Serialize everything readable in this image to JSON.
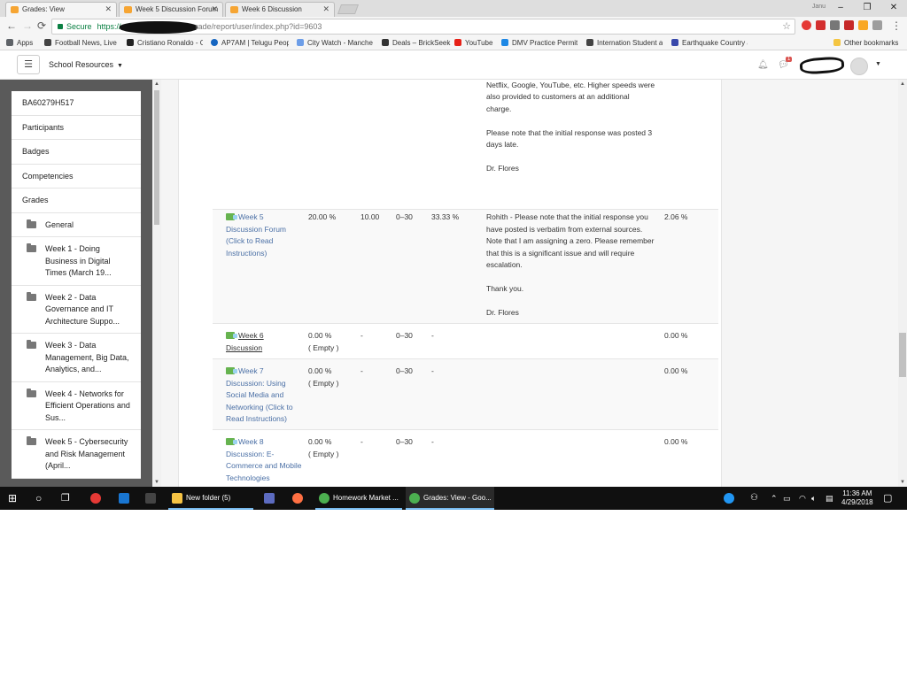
{
  "browser": {
    "tabs": [
      {
        "label": "Grades: View",
        "active": true
      },
      {
        "label": "Week 5 Discussion Forum",
        "active": false
      },
      {
        "label": "Week 6 Discussion",
        "active": false
      }
    ],
    "profile_name": "Janu",
    "window_controls": [
      "–",
      "❐",
      "✕"
    ],
    "address": {
      "secure_label": "Secure",
      "url_prefix": "https://",
      "url_suffix": "rade/report/user/index.php?id=9603"
    },
    "bookmarks": [
      {
        "label": "Apps",
        "icon_color": "#5f6368"
      },
      {
        "label": "Football News, Live S",
        "icon_color": "#444444"
      },
      {
        "label": "Cristiano Ronaldo - C",
        "icon_color": "#222222"
      },
      {
        "label": "AP7AM | Telugu Peop",
        "icon_color": "#1565c0"
      },
      {
        "label": "City Watch - Manche",
        "icon_color": "#6d9ee8"
      },
      {
        "label": "Deals – BrickSeek",
        "icon_color": "#333333"
      },
      {
        "label": "YouTube",
        "icon_color": "#e62117"
      },
      {
        "label": "DMV Practice Permit",
        "icon_color": "#1e88e5"
      },
      {
        "label": "Internation Student a",
        "icon_color": "#444444"
      },
      {
        "label": "Earthquake Country a",
        "icon_color": "#3949ab"
      },
      {
        "label": "Other bookmarks",
        "icon_color": "#f4c542"
      }
    ]
  },
  "navbar": {
    "menu_icon": "☰",
    "site_menu_label": "School Resources",
    "message_count": "1"
  },
  "drawer": {
    "items": [
      "BA60279H517",
      "Participants",
      "Badges",
      "Competencies",
      "Grades"
    ],
    "sections": [
      "General",
      "Week 1 - Doing Business in Digital Times (March 19...",
      "Week 2 - Data Governance and IT Architecture Suppo...",
      "Week 3 - Data Management, Big Data, Analytics, and...",
      "Week 4 - Networks for Efficient Operations and Sus...",
      "Week 5 - Cybersecurity and Risk Management (April..."
    ]
  },
  "grades": {
    "top_feedback": [
      "accessing information for big businesses such as Netflix, Google, YouTube, etc. Higher speeds were also provided to customers at an additional charge.",
      "Please note that the initial response was posted 3 days late.",
      "Dr. Flores"
    ],
    "rows": [
      {
        "item": "Week 5 Discussion Forum (Click to Read Instructions)",
        "weight": "20.00 %",
        "grade": "10.00",
        "range": "0–30",
        "percentage": "33.33 %",
        "feedback": [
          "Rohith - Please note that the initial response you have posted is verbatim from external sources. Note that I am assigning a zero. Please remember that this is a significant issue and will require escalation.",
          "Thank you.",
          "Dr. Flores"
        ],
        "contribution": "2.06 %"
      },
      {
        "item": "Week 6 Discussion",
        "weight": "0.00 %",
        "weight_note": "( Empty )",
        "grade": "-",
        "range": "0–30",
        "percentage": "-",
        "contribution": "0.00 %"
      },
      {
        "item": "Week 7 Discussion: Using Social Media and Networking (Click to Read Instructions)",
        "weight": "0.00 %",
        "weight_note": "( Empty )",
        "grade": "-",
        "range": "0–30",
        "percentage": "-",
        "contribution": "0.00 %"
      },
      {
        "item": "Week 8 Discussion: E-Commerce and Mobile Technologies",
        "weight": "0.00 %",
        "weight_note": "( Empty )",
        "grade": "-",
        "range": "0–30",
        "percentage": "-",
        "contribution": "0.00 %"
      }
    ]
  },
  "taskbar": {
    "apps": [
      {
        "label": "New folder (5)",
        "icon_color": "#f6c344"
      },
      {
        "label": "Homework Market ...",
        "icon_color": "#4caf50"
      },
      {
        "label": "Grades: View - Goo...",
        "icon_color": "#4caf50"
      }
    ],
    "time": "11:36 AM",
    "date": "4/29/2018"
  }
}
